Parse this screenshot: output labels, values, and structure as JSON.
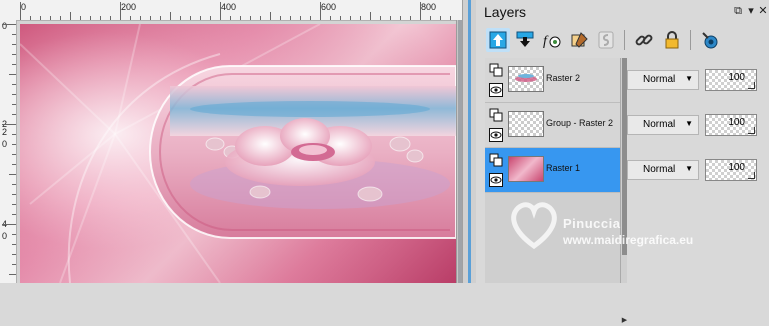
{
  "rulers": {
    "horizontal_labels": [
      "0",
      "200",
      "400",
      "600",
      "800"
    ],
    "vertical_labels": [
      "0",
      "2",
      "2",
      "0",
      "4",
      "0"
    ]
  },
  "layers_panel": {
    "title": "Layers",
    "window_buttons": {
      "restore": "⧉",
      "menu": "▾",
      "close": "✕"
    },
    "toolbar": [
      {
        "name": "new-raster-layer-icon"
      },
      {
        "name": "new-vector-layer-icon"
      },
      {
        "name": "fx-effects-icon"
      },
      {
        "name": "layer-properties-icon"
      },
      {
        "name": "link-layer-icon"
      },
      {
        "name": "chain-link-icon"
      },
      {
        "name": "lock-icon"
      },
      {
        "name": "layer-visibility-icon"
      }
    ],
    "layers": [
      {
        "name": "Raster 2",
        "blend_mode": "Normal",
        "opacity": "100",
        "selected": false
      },
      {
        "name": "Group - Raster 2",
        "blend_mode": "Normal",
        "opacity": "100",
        "selected": false
      },
      {
        "name": "Raster 1",
        "blend_mode": "Normal",
        "opacity": "100",
        "selected": true
      }
    ]
  },
  "watermark": {
    "line1": "Pinuccia",
    "line2": "www.maidiregrafica.eu"
  },
  "colors": {
    "selection_blue": "#3797f0",
    "accent_blue": "#5aa0d8",
    "panel_gray": "#d9d9d9"
  }
}
